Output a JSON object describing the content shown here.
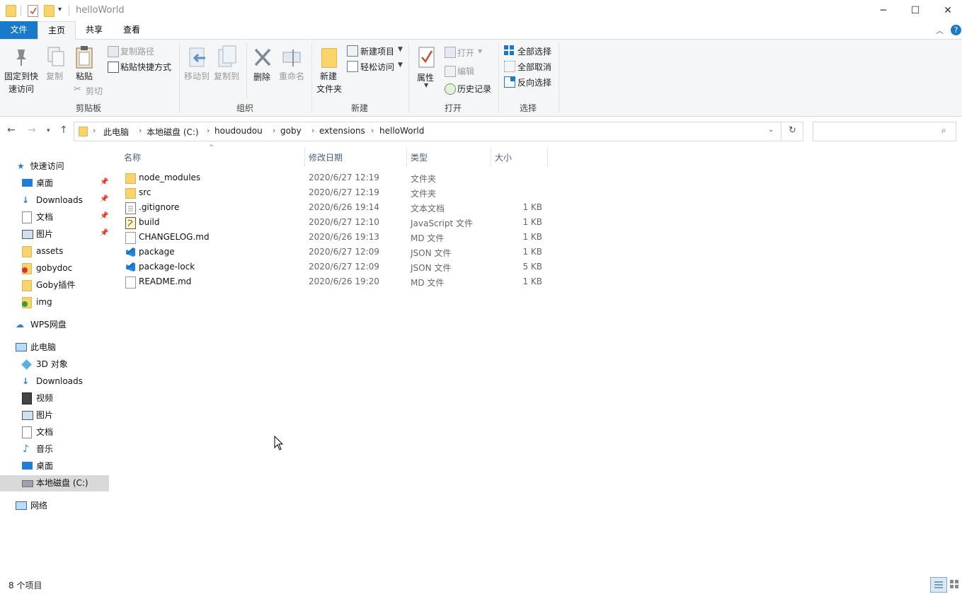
{
  "window": {
    "title": "helloWorld",
    "controls": {
      "minimize": "─",
      "maximize": "☐",
      "close": "✕"
    }
  },
  "ribbon_tabs": [
    "文件",
    "主页",
    "共享",
    "查看"
  ],
  "ribbon": {
    "clipboard": {
      "label": "剪贴板",
      "pin": "固定到快\n速访问",
      "pin_l1": "固定到快",
      "pin_l2": "速访问",
      "copy": "复制",
      "paste": "粘贴",
      "copy_path": "复制路径",
      "paste_shortcut": "粘贴快捷方式",
      "cut": "剪切"
    },
    "organize": {
      "label": "组织",
      "move_to": "移动到",
      "copy_to": "复制到",
      "delete": "删除",
      "rename": "重命名"
    },
    "new": {
      "label": "新建",
      "new_folder_l1": "新建",
      "new_folder_l2": "文件夹",
      "new_item": "新建项目",
      "easy_access": "轻松访问"
    },
    "open": {
      "label": "打开",
      "properties": "属性",
      "open": "打开",
      "edit": "编辑",
      "history": "历史记录"
    },
    "select": {
      "label": "选择",
      "select_all": "全部选择",
      "select_none": "全部取消",
      "invert": "反向选择"
    }
  },
  "breadcrumb": [
    "此电脑",
    "本地磁盘 (C:)",
    "houdoudou",
    "goby",
    "extensions",
    "helloWorld"
  ],
  "search": {
    "placeholder": ""
  },
  "nav": {
    "quick_access": "快速访问",
    "quick_items": [
      "桌面",
      "Downloads",
      "文档",
      "图片",
      "assets",
      "gobydoc",
      "Goby插件",
      "img"
    ],
    "wps": "WPS网盘",
    "this_pc": "此电脑",
    "pc_items": [
      "3D 对象",
      "Downloads",
      "视频",
      "图片",
      "文档",
      "音乐",
      "桌面",
      "本地磁盘 (C:)"
    ],
    "network": "网络"
  },
  "columns": {
    "name": "名称",
    "date": "修改日期",
    "type": "类型",
    "size": "大小"
  },
  "files": [
    {
      "name": "node_modules",
      "date": "2020/6/27 12:19",
      "type": "文件夹",
      "size": "",
      "icon": "folder-icon"
    },
    {
      "name": "src",
      "date": "2020/6/27 12:19",
      "type": "文件夹",
      "size": "",
      "icon": "folder-icon"
    },
    {
      "name": ".gitignore",
      "date": "2020/6/26 19:14",
      "type": "文本文档",
      "size": "1 KB",
      "icon": "text-file-icon"
    },
    {
      "name": "build",
      "date": "2020/6/27 12:10",
      "type": "JavaScript 文件",
      "size": "1 KB",
      "icon": "js-file-icon"
    },
    {
      "name": "CHANGELOG.md",
      "date": "2020/6/26 19:13",
      "type": "MD 文件",
      "size": "1 KB",
      "icon": "blank-file-icon"
    },
    {
      "name": "package",
      "date": "2020/6/27 12:09",
      "type": "JSON 文件",
      "size": "1 KB",
      "icon": "vscode-icon"
    },
    {
      "name": "package-lock",
      "date": "2020/6/27 12:09",
      "type": "JSON 文件",
      "size": "5 KB",
      "icon": "vscode-icon"
    },
    {
      "name": "README.md",
      "date": "2020/6/26 19:20",
      "type": "MD 文件",
      "size": "1 KB",
      "icon": "blank-file-icon"
    }
  ],
  "status": {
    "count": "8 个项目"
  },
  "colors": {
    "accent": "#1979ca",
    "folder": "#f9d46b",
    "selected": "#d9d9d9"
  }
}
